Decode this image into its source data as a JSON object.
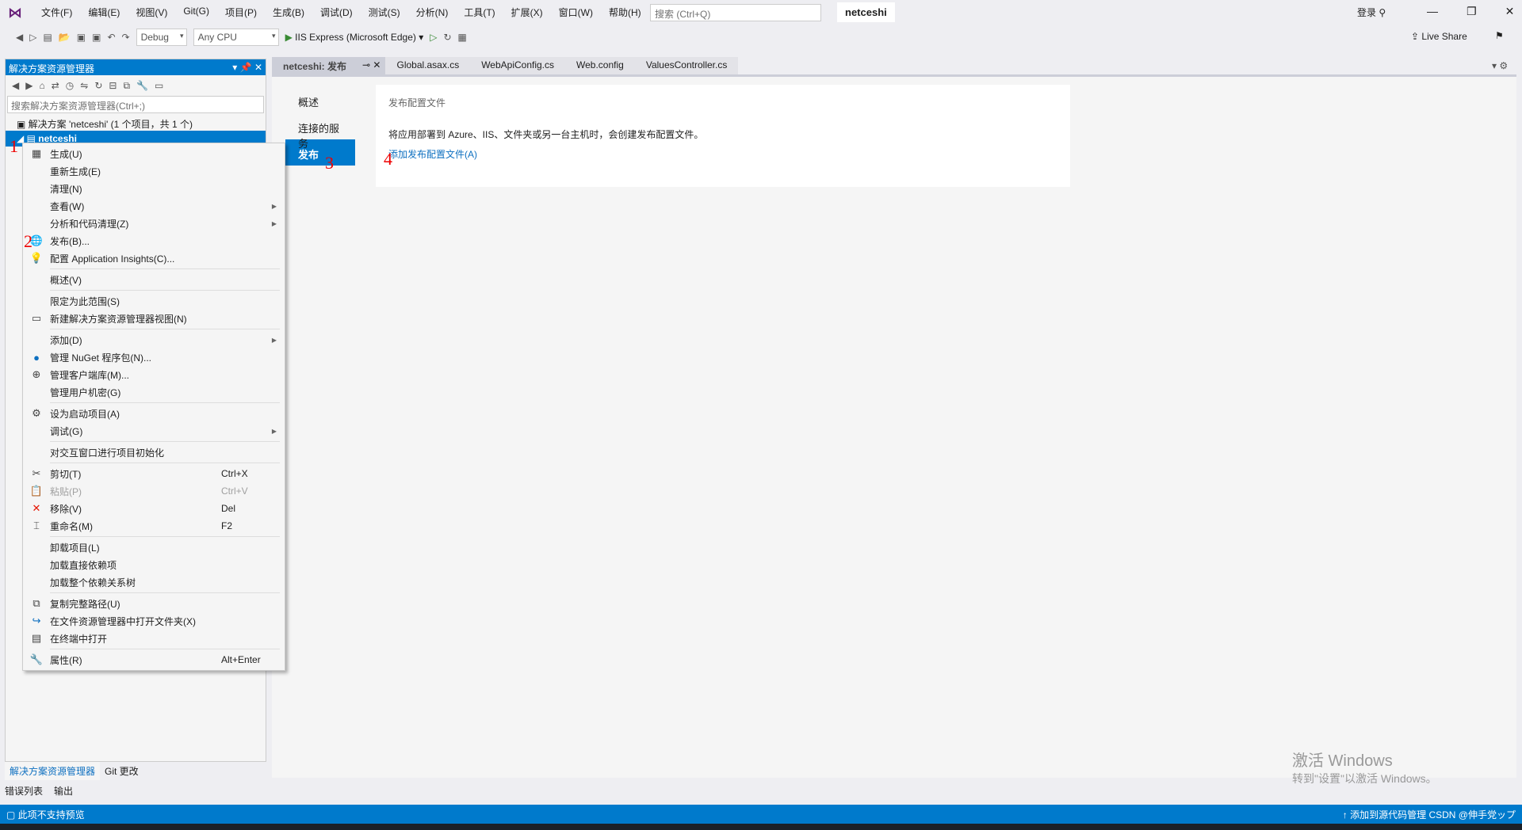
{
  "menu": [
    "文件(F)",
    "编辑(E)",
    "视图(V)",
    "Git(G)",
    "项目(P)",
    "生成(B)",
    "调试(D)",
    "测试(S)",
    "分析(N)",
    "工具(T)",
    "扩展(X)",
    "窗口(W)",
    "帮助(H)"
  ],
  "search_placeholder": "搜索 (Ctrl+Q)",
  "project_title": "netceshi",
  "login": "登录",
  "toolbar": {
    "config": "Debug",
    "platform": "Any CPU",
    "run": "IIS Express (Microsoft Edge)",
    "live_share": "Live Share"
  },
  "solution_explorer": {
    "title": "解决方案资源管理器",
    "search_placeholder": "搜索解决方案资源管理器(Ctrl+;)",
    "solution": "解决方案 'netceshi' (1 个项目，共 1 个)",
    "project": "netceshi",
    "bottom_tabs": [
      "解决方案资源管理器",
      "Git 更改"
    ]
  },
  "context_menu": [
    {
      "icon": "build-icon",
      "label": "生成(U)"
    },
    {
      "label": "重新生成(E)"
    },
    {
      "label": "清理(N)"
    },
    {
      "label": "查看(W)",
      "submenu": true
    },
    {
      "label": "分析和代码清理(Z)",
      "submenu": true
    },
    {
      "icon": "publish-icon",
      "label": "发布(B)..."
    },
    {
      "icon": "insights-icon",
      "label": "配置 Application Insights(C)..."
    },
    {
      "sep": true
    },
    {
      "label": "概述(V)"
    },
    {
      "sep": true
    },
    {
      "label": "限定为此范围(S)"
    },
    {
      "icon": "new-view-icon",
      "label": "新建解决方案资源管理器视图(N)"
    },
    {
      "sep": true
    },
    {
      "label": "添加(D)",
      "submenu": true
    },
    {
      "icon": "nuget-icon",
      "label": "管理 NuGet 程序包(N)..."
    },
    {
      "icon": "library-icon",
      "label": "管理客户端库(M)..."
    },
    {
      "label": "管理用户机密(G)"
    },
    {
      "sep": true
    },
    {
      "icon": "gear-icon",
      "label": "设为启动项目(A)"
    },
    {
      "label": "调试(G)",
      "submenu": true
    },
    {
      "sep": true
    },
    {
      "label": "对交互窗口进行项目初始化"
    },
    {
      "sep": true
    },
    {
      "icon": "scissors-icon",
      "label": "剪切(T)",
      "shortcut": "Ctrl+X"
    },
    {
      "icon": "paste-icon",
      "label": "粘贴(P)",
      "shortcut": "Ctrl+V",
      "disabled": true
    },
    {
      "icon": "remove-icon",
      "label": "移除(V)",
      "shortcut": "Del"
    },
    {
      "icon": "rename-icon",
      "label": "重命名(M)",
      "shortcut": "F2"
    },
    {
      "sep": true
    },
    {
      "label": "卸载项目(L)"
    },
    {
      "label": "加载直接依赖项"
    },
    {
      "label": "加载整个依赖关系树"
    },
    {
      "sep": true
    },
    {
      "icon": "copy-icon",
      "label": "复制完整路径(U)"
    },
    {
      "icon": "open-folder-icon",
      "label": "在文件资源管理器中打开文件夹(X)"
    },
    {
      "icon": "terminal-icon",
      "label": "在终端中打开"
    },
    {
      "sep": true
    },
    {
      "icon": "wrench-icon",
      "label": "属性(R)",
      "shortcut": "Alt+Enter"
    }
  ],
  "doc_tabs": [
    "netceshi: 发布",
    "Global.asax.cs",
    "WebApiConfig.cs",
    "Web.config",
    "ValuesController.cs"
  ],
  "publish": {
    "nav": [
      "概述",
      "连接的服务",
      "发布"
    ],
    "card_title": "发布配置文件",
    "desc": "将应用部署到 Azure、IIS、文件夹或另一台主机时，会创建发布配置文件。",
    "link": "添加发布配置文件(A)"
  },
  "annotations": [
    "1",
    "2",
    "3",
    "4"
  ],
  "bottom_tabs": [
    "错误列表",
    "输出"
  ],
  "watermark": {
    "line1": "激活 Windows",
    "line2": "转到\"设置\"以激活 Windows。"
  },
  "status": {
    "left": "此项不支持预览",
    "right": "添加到源代码管理",
    "right2": "CSDN @伸手党ップ"
  }
}
